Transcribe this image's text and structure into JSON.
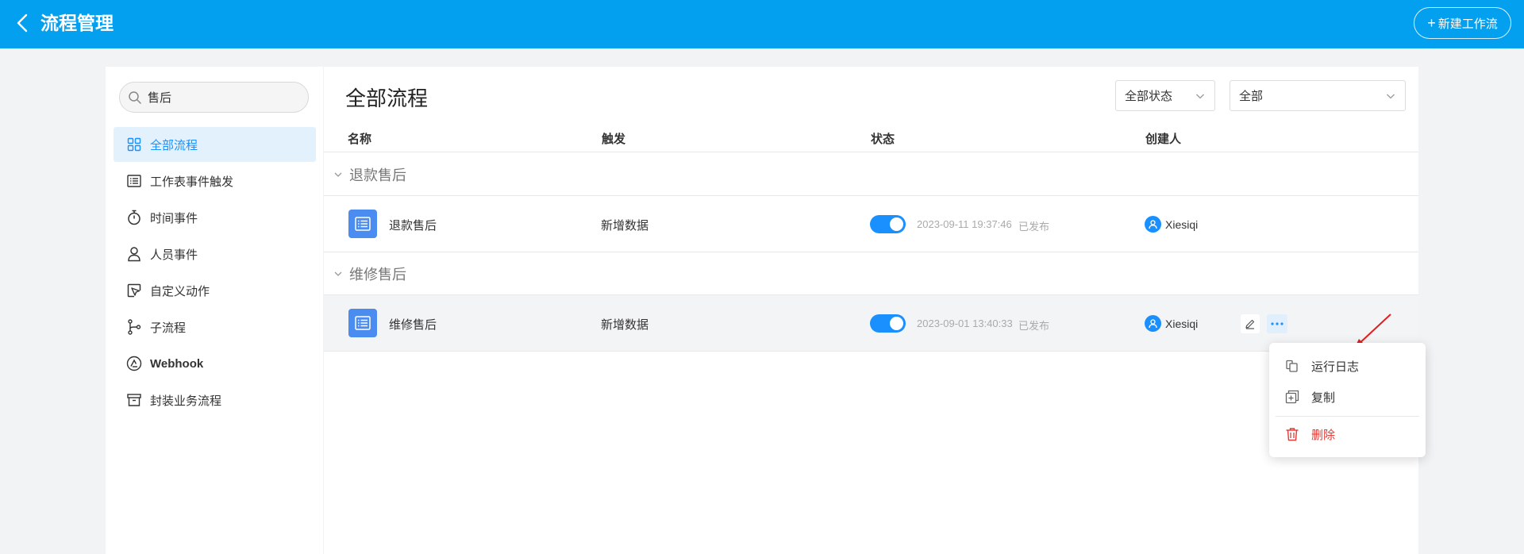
{
  "header": {
    "title": "流程管理",
    "new_button": "新建工作流"
  },
  "search": {
    "value": "售后",
    "placeholder": ""
  },
  "sidebar": {
    "items": [
      {
        "label": "全部流程",
        "icon": "grid-icon",
        "active": true
      },
      {
        "label": "工作表事件触发",
        "icon": "list-icon",
        "active": false
      },
      {
        "label": "时间事件",
        "icon": "stopwatch-icon",
        "active": false
      },
      {
        "label": "人员事件",
        "icon": "person-icon",
        "active": false
      },
      {
        "label": "自定义动作",
        "icon": "cursor-icon",
        "active": false
      },
      {
        "label": "子流程",
        "icon": "branch-icon",
        "active": false
      },
      {
        "label": "Webhook",
        "icon": "webhook-icon",
        "active": false
      },
      {
        "label": "封装业务流程",
        "icon": "archive-icon",
        "active": false
      }
    ]
  },
  "main": {
    "title": "全部流程",
    "filters": {
      "status": "全部状态",
      "scope": "全部"
    },
    "columns": {
      "name": "名称",
      "trigger": "触发",
      "status": "状态",
      "creator": "创建人"
    },
    "groups": [
      {
        "label": "退款售后",
        "rows": [
          {
            "name": "退款售后",
            "trigger": "新增数据",
            "enabled": true,
            "time": "2023-09-11 19:37:46",
            "status": "已发布",
            "creator": "Xiesiqi"
          }
        ]
      },
      {
        "label": "维修售后",
        "rows": [
          {
            "name": "维修售后",
            "trigger": "新增数据",
            "enabled": true,
            "time": "2023-09-01 13:40:33",
            "status": "已发布",
            "creator": "Xiesiqi"
          }
        ]
      }
    ]
  },
  "menu": {
    "run_log": "运行日志",
    "copy": "复制",
    "delete": "删除"
  },
  "colors": {
    "header_bg": "#03a0f0",
    "accent": "#1a90ff",
    "danger": "#e53935",
    "active_bg": "#e3f1fd"
  }
}
